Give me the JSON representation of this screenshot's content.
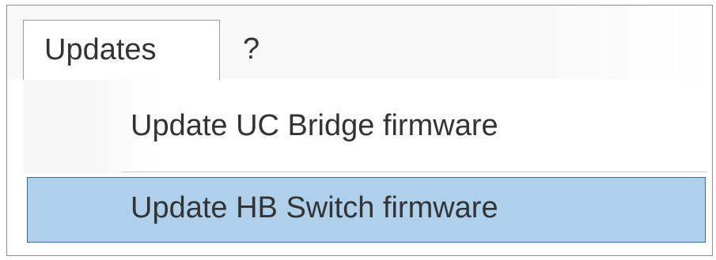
{
  "menubar": {
    "items": [
      {
        "label": "Updates"
      },
      {
        "label": "?"
      }
    ]
  },
  "dropdown": {
    "items": [
      {
        "label": "Update UC Bridge firmware"
      },
      {
        "label": "Update HB Switch firmware",
        "highlighted": true
      }
    ]
  },
  "colors": {
    "highlight_bg": "#aed0ea",
    "highlight_border": "#2f6fa3",
    "text": "#333333"
  }
}
